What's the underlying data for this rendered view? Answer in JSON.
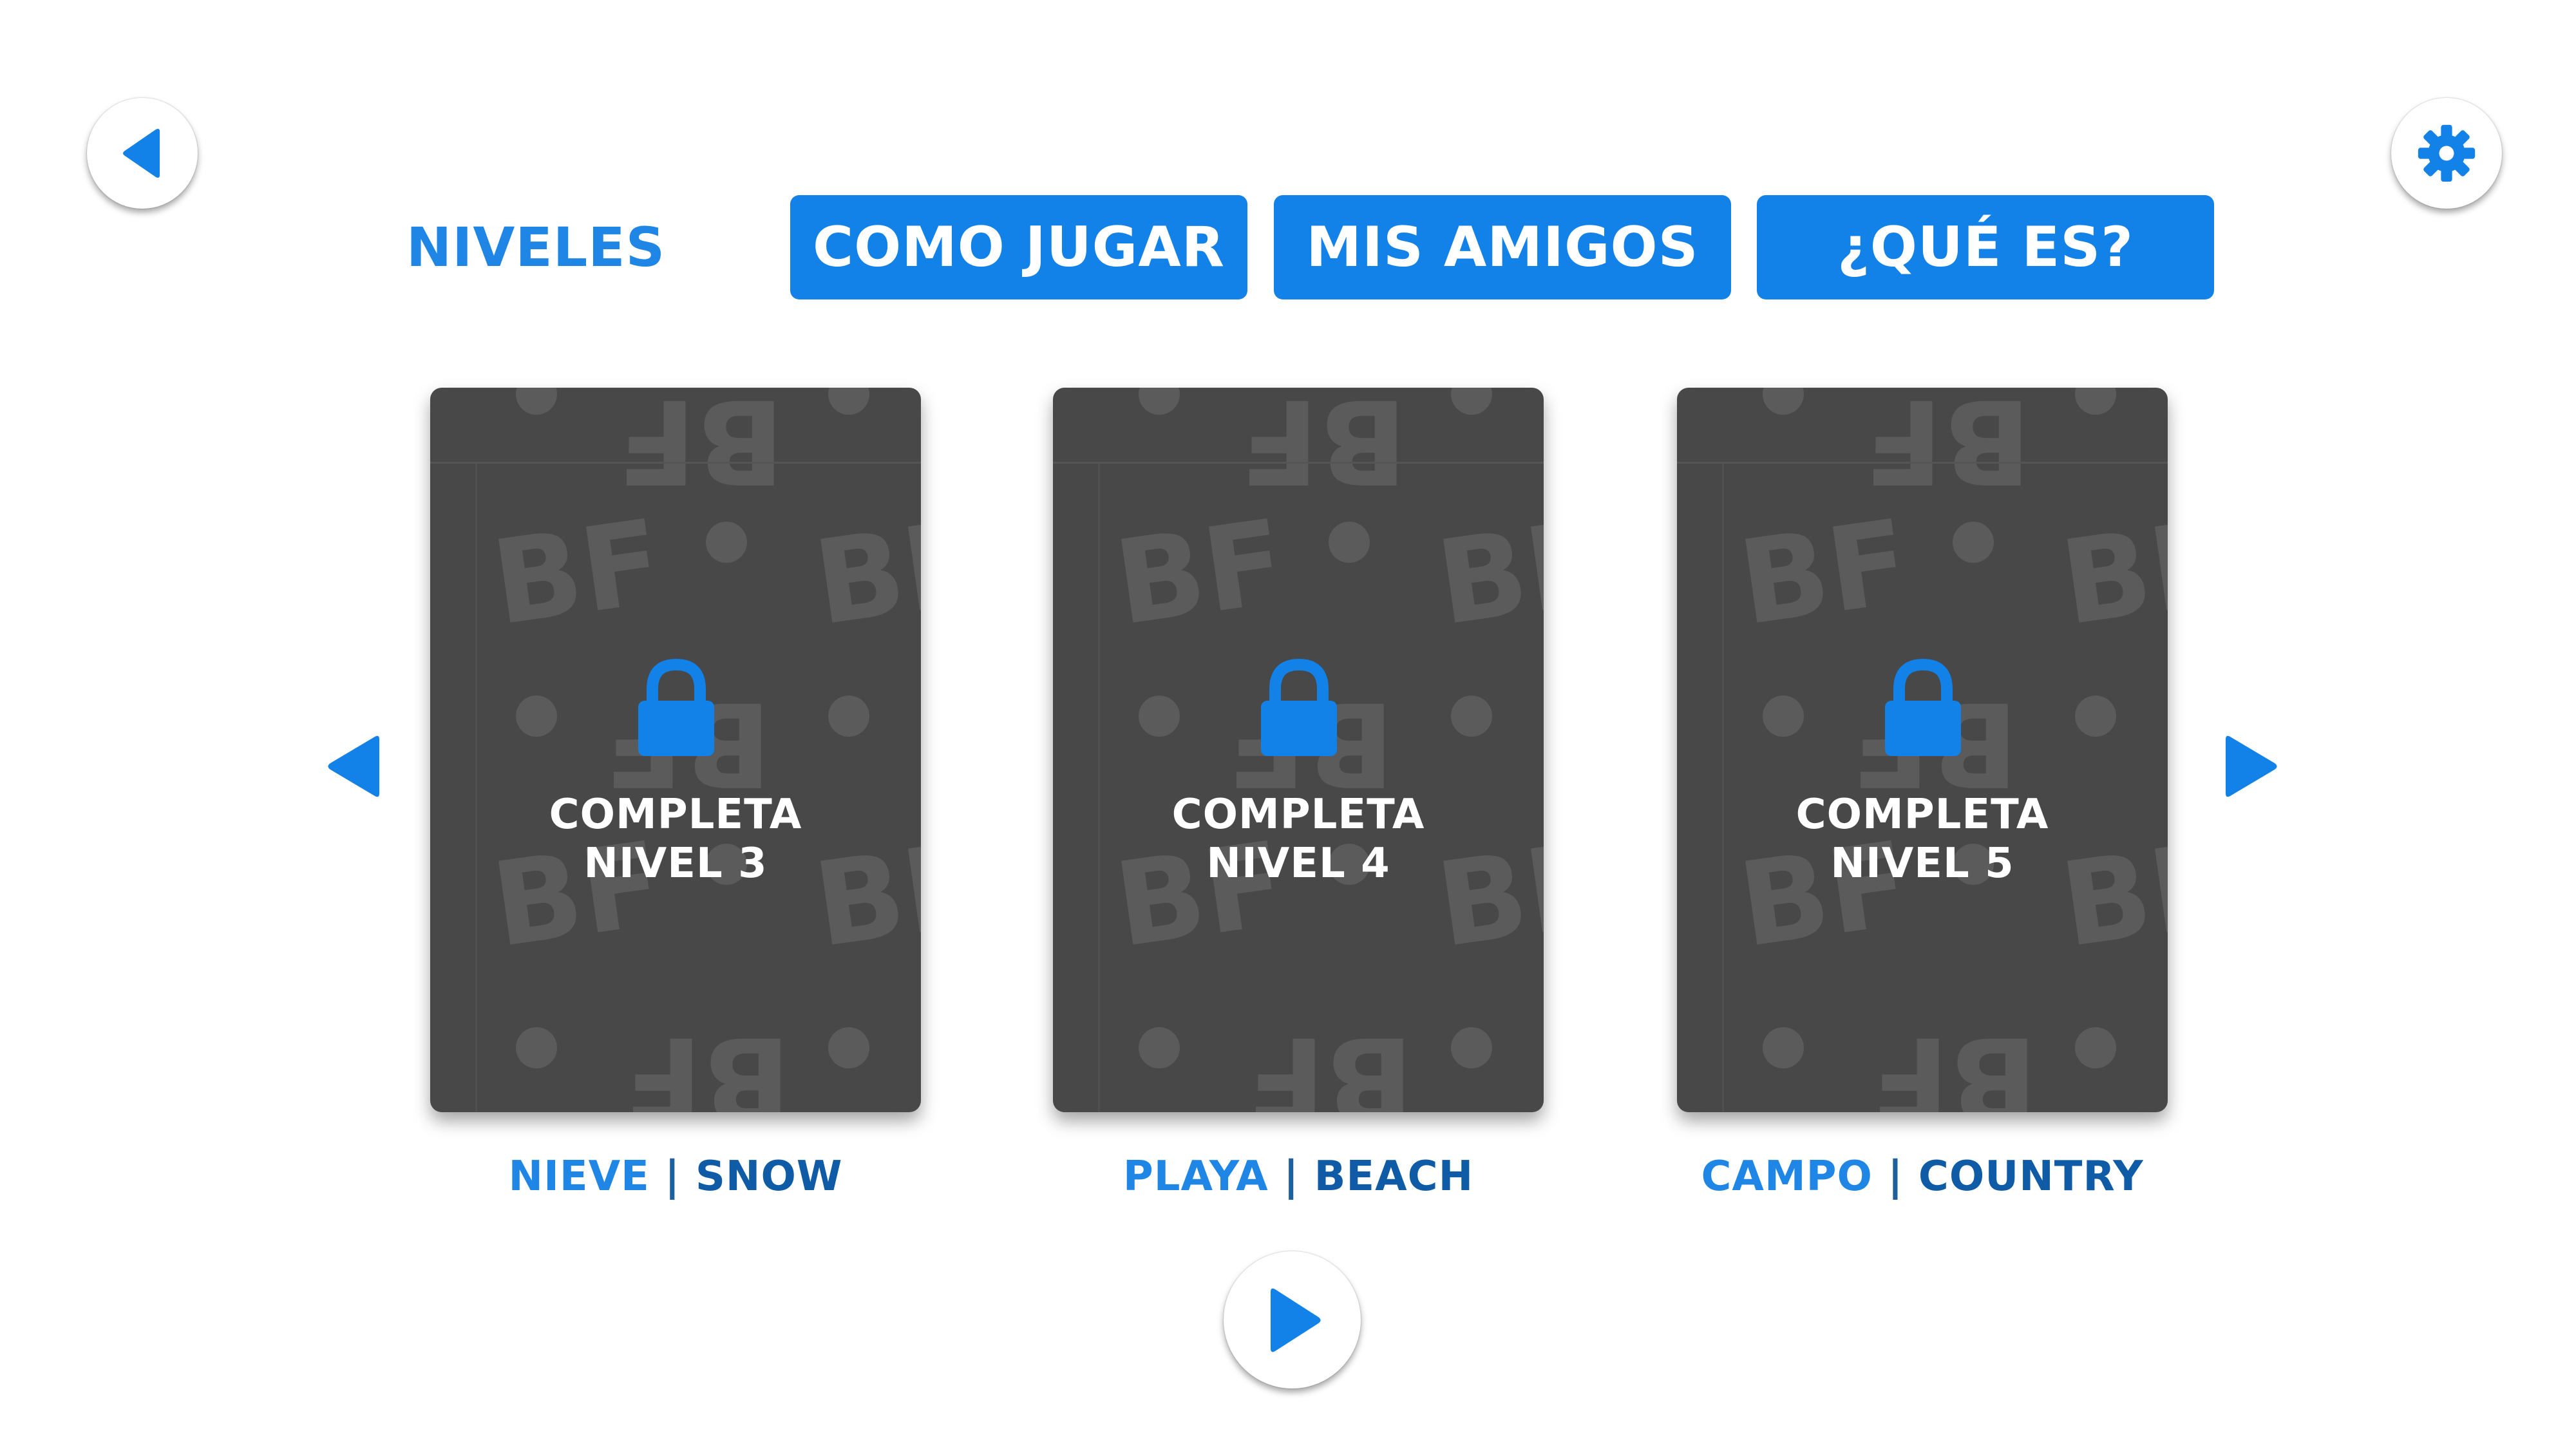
{
  "header": {
    "back_icon": "back-arrow-icon",
    "settings_icon": "gear-icon"
  },
  "tabs": [
    {
      "label": "NIVELES",
      "active": true
    },
    {
      "label": "COMO JUGAR",
      "active": false
    },
    {
      "label": "MIS AMIGOS",
      "active": false
    },
    {
      "label": "¿QUÉ ES?",
      "active": false
    }
  ],
  "cards": [
    {
      "locked": true,
      "lock_line1": "COMPLETA",
      "lock_line2": "NIVEL 3",
      "caption_es": "NIEVE",
      "separator": "|",
      "caption_en": "SNOW"
    },
    {
      "locked": true,
      "lock_line1": "COMPLETA",
      "lock_line2": "NIVEL 4",
      "caption_es": "PLAYA",
      "separator": "|",
      "caption_en": "BEACH"
    },
    {
      "locked": true,
      "lock_line1": "COMPLETA",
      "lock_line2": "NIVEL 5",
      "caption_es": "CAMPO",
      "separator": "|",
      "caption_en": "COUNTRY"
    }
  ],
  "pattern_text": "BF",
  "colors": {
    "accent": "#1281e8",
    "accent_text": "#1f86e6",
    "accent_dark": "#0f5ba6",
    "card_bg": "#484848",
    "pattern": "#5b5b5b"
  },
  "icons": {
    "nav_left": "chevron-left-icon",
    "nav_right": "chevron-right-icon",
    "play": "play-icon",
    "lock": "lock-icon"
  }
}
